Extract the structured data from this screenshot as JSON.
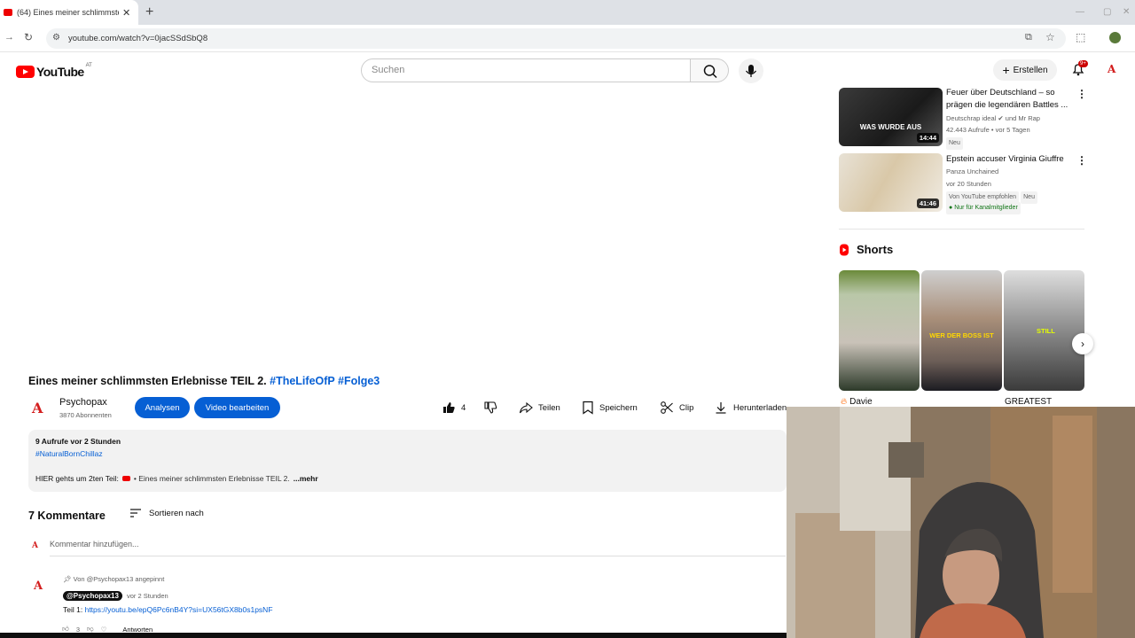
{
  "browser": {
    "tab_title": "(64) Eines meiner schlimmsten",
    "tab_close": "✕",
    "new_tab": "+",
    "url": "youtube.com/watch?v=0jacSSdSbQ8"
  },
  "header": {
    "logo_text": "YouTube",
    "logo_country": "AT",
    "search_placeholder": "Suchen",
    "create_label": "Erstellen",
    "notif_badge": "9+"
  },
  "video": {
    "title_plain": "Eines meiner schlimmsten Erlebnisse TEIL 2.",
    "title_tags": "#TheLifeOfP #Folge3",
    "channel_name": "Psychopax",
    "subscribers": "3870 Abonnenten",
    "analyze_label": "Analysen",
    "edit_label": "Video bearbeiten",
    "like_count": "4",
    "share_label": "Teilen",
    "save_label": "Speichern",
    "clip_label": "Clip",
    "download_label": "Herunterladen"
  },
  "description": {
    "meta": "9 Aufrufe  vor 2 Stunden",
    "hashtag": "#NaturalBornChillaz",
    "text_before": "HIER gehts um 2ten Teil:",
    "linked_video": "• Eines meiner schlimmsten Erlebnisse TEIL 2.",
    "more": "...mehr"
  },
  "comments": {
    "count_label": "7 Kommentare",
    "sort_label": "Sortieren nach",
    "add_placeholder": "Kommentar hinzufügen...",
    "pinned_note": "Von @Psychopax13 angepinnt",
    "author": "@Psychopax13",
    "time": "vor 2 Stunden",
    "text_prefix": "Teil 1:",
    "text_link": "https://youtu.be/epQ6Pc6nB4Y?si=UX56tGX8b0s1psNF",
    "like_count": "3",
    "reply_label": "Antworten"
  },
  "related": [
    {
      "title": "Feuer über Deutschland – so prägen die legendären Battles ...",
      "channel": "Deutschrap ideal",
      "collab": "und Mr Rap",
      "views": "42.443 Aufrufe • vor 5 Tagen",
      "badge": "Neu",
      "duration": "14:44",
      "thumb_text": "WAS WURDE AUS"
    },
    {
      "title": "Epstein accuser Virginia Giuffre",
      "channel": "Panza Unchained",
      "views": "vor 20 Stunden",
      "badge_1": "Von YouTube empfohlen",
      "badge_2": "Neu",
      "members": "Nur für Kanalmitglieder",
      "duration": "41:46"
    }
  ],
  "shorts": {
    "heading": "Shorts",
    "items": [
      {
        "label": "Davie",
        "overlay": ""
      },
      {
        "label": "",
        "overlay": "WER DER BOSS IST"
      },
      {
        "label": "GREATEST",
        "overlay": "STILL"
      }
    ]
  },
  "colors": {
    "accent_blue": "#065fd4",
    "youtube_red": "#ff0000"
  }
}
